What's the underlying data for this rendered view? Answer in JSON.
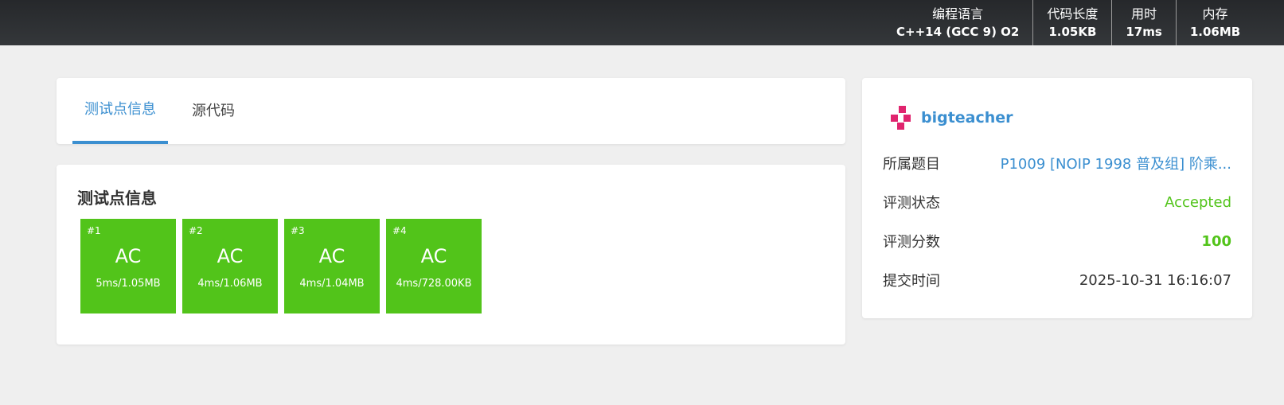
{
  "header": {
    "stats": [
      {
        "label": "编程语言",
        "value": "C++14 (GCC 9) O2"
      },
      {
        "label": "代码长度",
        "value": "1.05KB"
      },
      {
        "label": "用时",
        "value": "17ms"
      },
      {
        "label": "内存",
        "value": "1.06MB"
      }
    ]
  },
  "tabs": {
    "testcases": "测试点信息",
    "source": "源代码"
  },
  "testcases": {
    "title": "测试点信息",
    "items": [
      {
        "num": "#1",
        "status": "AC",
        "info": "5ms/1.05MB"
      },
      {
        "num": "#2",
        "status": "AC",
        "info": "4ms/1.06MB"
      },
      {
        "num": "#3",
        "status": "AC",
        "info": "4ms/1.04MB"
      },
      {
        "num": "#4",
        "status": "AC",
        "info": "4ms/728.00KB"
      }
    ]
  },
  "submission": {
    "username": "bigteacher",
    "problem_label": "所属题目",
    "problem_value": "P1009 [NOIP 1998 普及组] 阶乘...",
    "status_label": "评测状态",
    "status_value": "Accepted",
    "score_label": "评测分数",
    "score_value": "100",
    "time_label": "提交时间",
    "time_value": "2025-10-31 16:16:07"
  },
  "colors": {
    "accent": "#3b8fd0",
    "ac_green": "#52c41a",
    "avatar_pink": "#e0246e"
  }
}
